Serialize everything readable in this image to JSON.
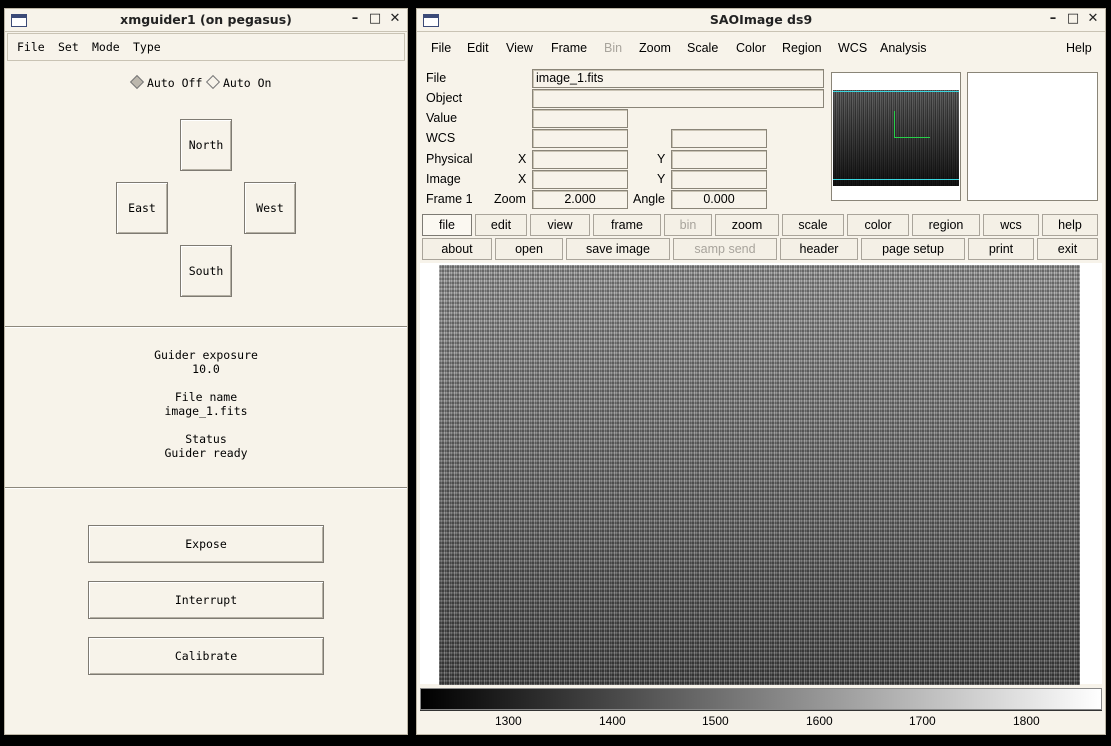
{
  "guider": {
    "title": "xmguider1 (on pegasus)",
    "menu": [
      "File",
      "Set",
      "Mode",
      "Type"
    ],
    "auto_off": "Auto Off",
    "auto_on": "Auto On",
    "dir": {
      "north": "North",
      "south": "South",
      "east": "East",
      "west": "West"
    },
    "exposure_label": "Guider exposure",
    "exposure_value": "10.0",
    "filename_label": "File name",
    "filename_value": "image_1.fits",
    "status_label": "Status",
    "status_value": "Guider ready",
    "buttons": {
      "expose": "Expose",
      "interrupt": "Interrupt",
      "calibrate": "Calibrate"
    }
  },
  "ds9": {
    "title": "SAOImage ds9",
    "menu": [
      "File",
      "Edit",
      "View",
      "Frame",
      "Bin",
      "Zoom",
      "Scale",
      "Color",
      "Region",
      "WCS",
      "Analysis",
      "Help"
    ],
    "info": {
      "file_label": "File",
      "file_value": "image_1.fits",
      "object_label": "Object",
      "value_label": "Value",
      "wcs_label": "WCS",
      "physical_label": "Physical",
      "image_label": "Image",
      "x_label": "X",
      "y_label": "Y",
      "frame_label": "Frame 1",
      "zoom_label": "Zoom",
      "zoom_value": "2.000",
      "angle_label": "Angle",
      "angle_value": "0.000"
    },
    "buttonbar1": [
      "file",
      "edit",
      "view",
      "frame",
      "bin",
      "zoom",
      "scale",
      "color",
      "region",
      "wcs",
      "help"
    ],
    "buttonbar2": [
      "about",
      "open",
      "save image",
      "samp send",
      "header",
      "page setup",
      "print",
      "exit"
    ],
    "colorbar_ticks": [
      "1300",
      "1400",
      "1500",
      "1600",
      "1700",
      "1800"
    ]
  }
}
